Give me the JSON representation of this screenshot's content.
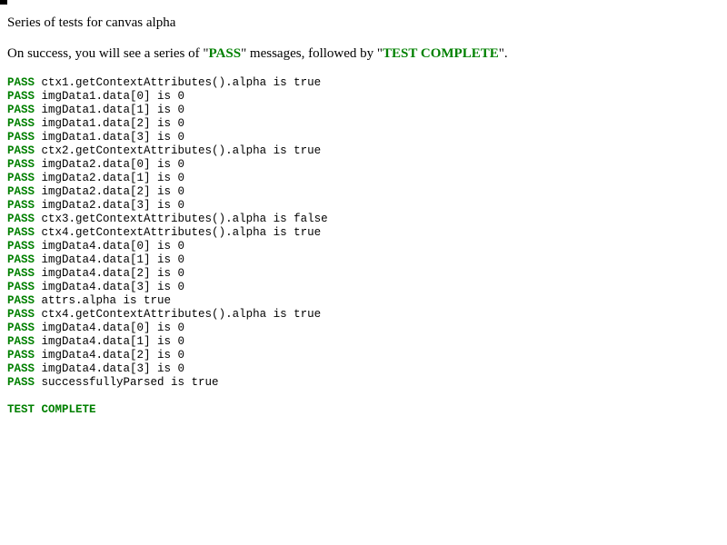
{
  "title": "Series of tests for canvas alpha",
  "description": {
    "prefix": "On success, you will see a series of \"",
    "pass_word": "PASS",
    "middle": "\" messages, followed by \"",
    "complete_word": "TEST COMPLETE",
    "suffix": "\"."
  },
  "results": [
    {
      "status": "PASS",
      "message": "ctx1.getContextAttributes().alpha is true"
    },
    {
      "status": "PASS",
      "message": "imgData1.data[0] is 0"
    },
    {
      "status": "PASS",
      "message": "imgData1.data[1] is 0"
    },
    {
      "status": "PASS",
      "message": "imgData1.data[2] is 0"
    },
    {
      "status": "PASS",
      "message": "imgData1.data[3] is 0"
    },
    {
      "status": "PASS",
      "message": "ctx2.getContextAttributes().alpha is true"
    },
    {
      "status": "PASS",
      "message": "imgData2.data[0] is 0"
    },
    {
      "status": "PASS",
      "message": "imgData2.data[1] is 0"
    },
    {
      "status": "PASS",
      "message": "imgData2.data[2] is 0"
    },
    {
      "status": "PASS",
      "message": "imgData2.data[3] is 0"
    },
    {
      "status": "PASS",
      "message": "ctx3.getContextAttributes().alpha is false"
    },
    {
      "status": "PASS",
      "message": "ctx4.getContextAttributes().alpha is true"
    },
    {
      "status": "PASS",
      "message": "imgData4.data[0] is 0"
    },
    {
      "status": "PASS",
      "message": "imgData4.data[1] is 0"
    },
    {
      "status": "PASS",
      "message": "imgData4.data[2] is 0"
    },
    {
      "status": "PASS",
      "message": "imgData4.data[3] is 0"
    },
    {
      "status": "PASS",
      "message": "attrs.alpha is true"
    },
    {
      "status": "PASS",
      "message": "ctx4.getContextAttributes().alpha is true"
    },
    {
      "status": "PASS",
      "message": "imgData4.data[0] is 0"
    },
    {
      "status": "PASS",
      "message": "imgData4.data[1] is 0"
    },
    {
      "status": "PASS",
      "message": "imgData4.data[2] is 0"
    },
    {
      "status": "PASS",
      "message": "imgData4.data[3] is 0"
    },
    {
      "status": "PASS",
      "message": "successfullyParsed is true"
    }
  ],
  "completion": "TEST COMPLETE",
  "colors": {
    "pass": "#008000",
    "text": "#000000",
    "background": "#ffffff"
  }
}
